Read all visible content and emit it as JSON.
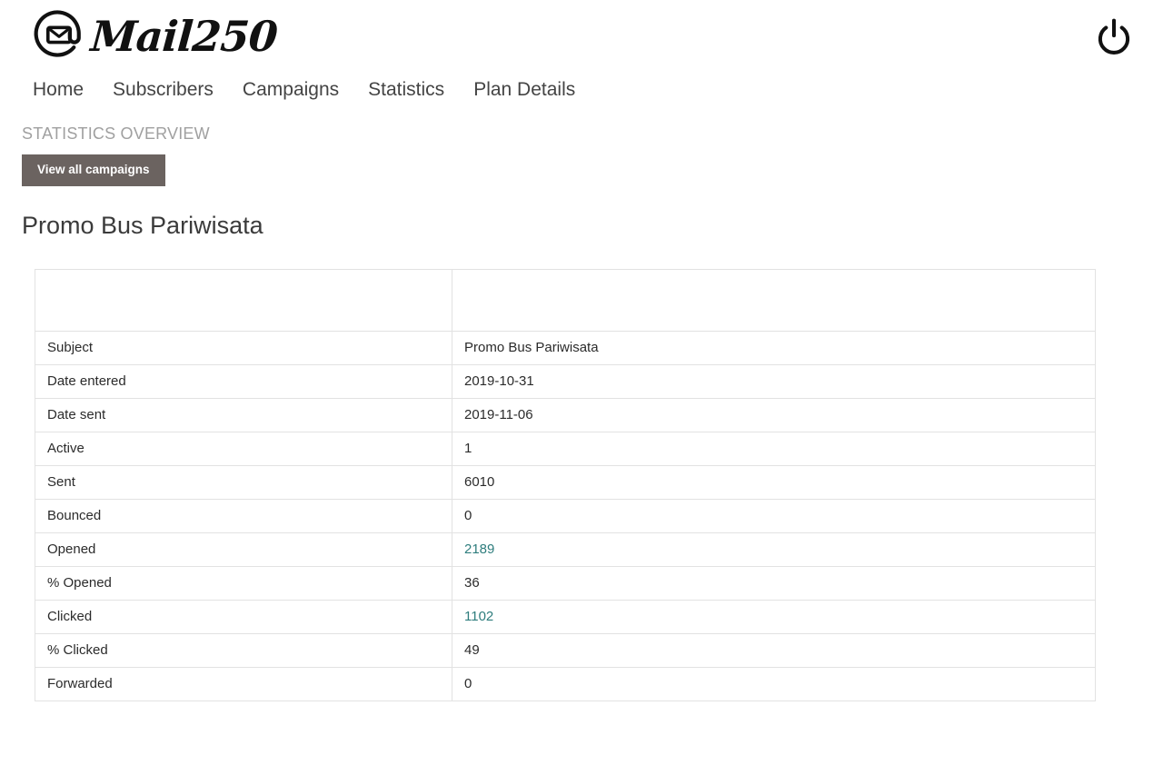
{
  "header": {
    "logo_mark": "at-envelope-icon",
    "logo_text": "Mail250",
    "power_icon": "power-icon"
  },
  "nav": {
    "items": [
      {
        "label": "Home"
      },
      {
        "label": "Subscribers"
      },
      {
        "label": "Campaigns"
      },
      {
        "label": "Statistics"
      },
      {
        "label": "Plan Details"
      }
    ]
  },
  "overview": {
    "section_label": "STATISTICS OVERVIEW",
    "view_all_button": "View all campaigns",
    "page_title": "Promo Bus Pariwisata"
  },
  "table": {
    "headers": [
      "",
      ""
    ],
    "rows": [
      {
        "label": "Subject",
        "value": "Promo Bus Pariwisata",
        "link": false
      },
      {
        "label": "Date entered",
        "value": "2019-10-31",
        "link": false
      },
      {
        "label": "Date sent",
        "value": "2019-11-06",
        "link": false
      },
      {
        "label": "Active",
        "value": "1",
        "link": false
      },
      {
        "label": "Sent",
        "value": "6010",
        "link": false
      },
      {
        "label": "Bounced",
        "value": "0",
        "link": false
      },
      {
        "label": "Opened",
        "value": "2189",
        "link": true
      },
      {
        "label": "% Opened",
        "value": "36",
        "link": false
      },
      {
        "label": "Clicked",
        "value": "1102",
        "link": true
      },
      {
        "label": "% Clicked",
        "value": "49",
        "link": false
      },
      {
        "label": "Forwarded",
        "value": "0",
        "link": false
      }
    ]
  },
  "colors": {
    "button_background": "#6b6360",
    "link": "#2e7d7d",
    "section_label": "#a0a0a0",
    "nav_text": "#444444",
    "table_border": "#e2e2e2"
  }
}
